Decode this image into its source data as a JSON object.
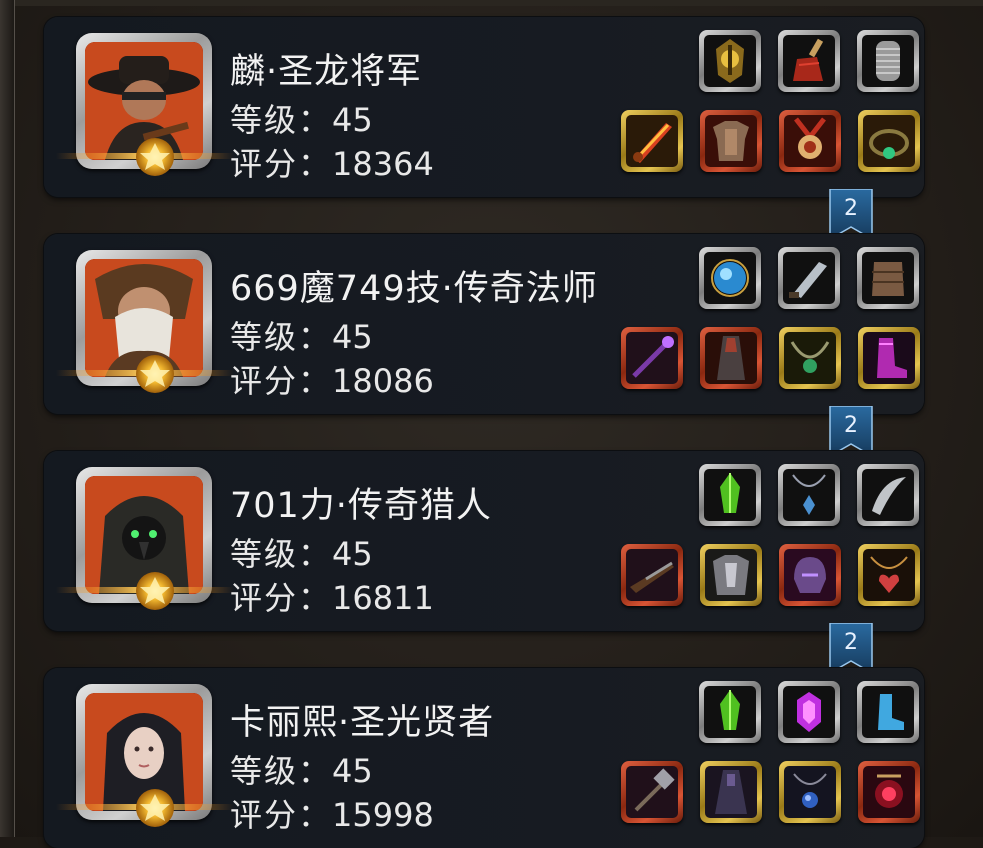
{
  "colors": {
    "card_bg": "#171b22",
    "portrait_red": "#c6401a",
    "ribbon_blue": "#1f4e78",
    "text": "#f2f2f2"
  },
  "players": [
    {
      "name": "麟·圣龙将军",
      "level_label": "等级：",
      "level": "45",
      "score_label": "评分：",
      "score": "18364",
      "portrait_icon": "hatted-warrior-portrait",
      "equipment": [
        {
          "icon": "gold-mask-icon",
          "rarity": "normal"
        },
        {
          "icon": "red-tassel-icon",
          "rarity": "normal"
        },
        {
          "icon": "chainmail-icon",
          "rarity": "normal"
        },
        {
          "icon": "flame-sword-icon",
          "rarity": "gold"
        },
        {
          "icon": "armor-icon",
          "rarity": "red"
        },
        {
          "icon": "medal-amulet-icon",
          "rarity": "red"
        },
        {
          "icon": "jade-ring-icon",
          "rarity": "gold"
        }
      ]
    },
    {
      "name": "669魔749技·传奇法师",
      "level_label": "等级：",
      "level": "45",
      "score_label": "评分：",
      "score": "18086",
      "portrait_icon": "bearded-sage-portrait",
      "equipment": [
        {
          "icon": "blue-orb-icon",
          "rarity": "normal"
        },
        {
          "icon": "dagger-icon",
          "rarity": "normal"
        },
        {
          "icon": "leather-armor-icon",
          "rarity": "normal"
        },
        {
          "icon": "purple-staff-icon",
          "rarity": "red"
        },
        {
          "icon": "dark-robe-icon",
          "rarity": "red"
        },
        {
          "icon": "green-necklace-icon",
          "rarity": "gold"
        },
        {
          "icon": "magenta-boots-icon",
          "rarity": "gold"
        }
      ]
    },
    {
      "name": "701力·传奇猎人",
      "level_label": "等级：",
      "level": "45",
      "score_label": "评分：",
      "score": "16811",
      "portrait_icon": "hooded-hunter-portrait",
      "equipment": [
        {
          "icon": "green-crystal-icon",
          "rarity": "normal"
        },
        {
          "icon": "blue-pendant-icon",
          "rarity": "normal"
        },
        {
          "icon": "curved-blade-icon",
          "rarity": "normal"
        },
        {
          "icon": "rifle-icon",
          "rarity": "red"
        },
        {
          "icon": "plate-armor-icon",
          "rarity": "gold"
        },
        {
          "icon": "purple-helm-icon",
          "rarity": "red"
        },
        {
          "icon": "heart-necklace-icon",
          "rarity": "gold"
        }
      ]
    },
    {
      "name": "卡丽熙·圣光贤者",
      "level_label": "等级：",
      "level": "45",
      "score_label": "评分：",
      "score": "15998",
      "portrait_icon": "hooded-lady-portrait",
      "equipment": [
        {
          "icon": "green-crystal-icon",
          "rarity": "normal"
        },
        {
          "icon": "purple-gem-icon",
          "rarity": "normal"
        },
        {
          "icon": "blue-boot-icon",
          "rarity": "normal"
        },
        {
          "icon": "hammer-icon",
          "rarity": "red"
        },
        {
          "icon": "shadow-robe-icon",
          "rarity": "gold"
        },
        {
          "icon": "sapphire-amulet-icon",
          "rarity": "gold"
        },
        {
          "icon": "ruby-talisman-icon",
          "rarity": "red"
        }
      ]
    }
  ],
  "ribbons": [
    "2",
    "2",
    "2"
  ]
}
